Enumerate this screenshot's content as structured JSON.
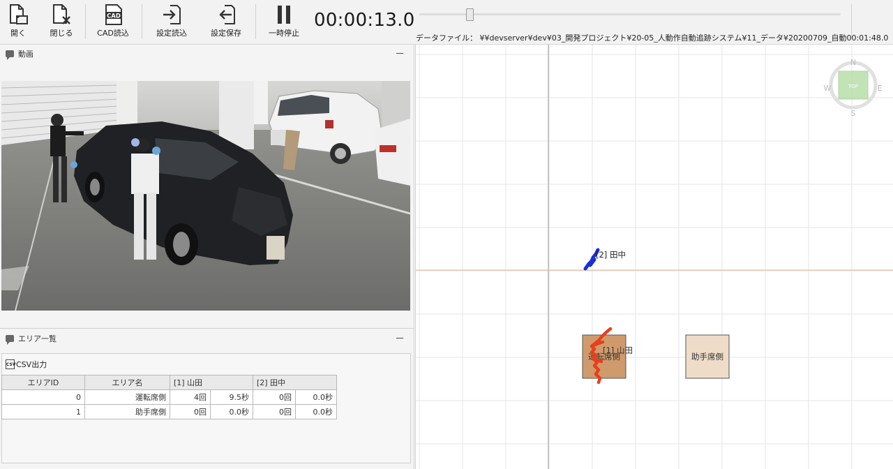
{
  "toolbar": {
    "open_label": "開く",
    "close_label": "閉じる",
    "cad_label": "CAD読込",
    "cad_icon_text": "CAD",
    "load_settings_label": "設定読込",
    "save_settings_label": "設定保存",
    "pause_label": "一時停止",
    "timer": "00:00:13.0",
    "playback_position": 0.12,
    "data_file": "データファイル： ¥¥devserver¥dev¥03_開発プロジェクト¥20-05_人動作自動追跡システム¥11_データ¥20200709_自動00:01:48.0"
  },
  "video_panel": {
    "title": "動画",
    "minimize": "－"
  },
  "area_panel": {
    "title": "エリア一覧",
    "minimize": "－",
    "csv_label": "CSV出力",
    "csv_icon_text": "CSV",
    "table": {
      "headers": [
        "エリアID",
        "エリア名",
        "[1] 山田",
        "[2] 田中"
      ],
      "rows": [
        {
          "id": "0",
          "name": "運転席側",
          "p1_count": "4回",
          "p1_time": "9.5秒",
          "p2_count": "0回",
          "p2_time": "0.0秒"
        },
        {
          "id": "1",
          "name": "助手席側",
          "p1_count": "0回",
          "p1_time": "0.0秒",
          "p2_count": "0回",
          "p2_time": "0.0秒"
        }
      ]
    }
  },
  "map": {
    "compass": {
      "n": "N",
      "s": "S",
      "e": "E",
      "w": "W",
      "top": "TOP"
    },
    "person_tanaka_label": "[2] 田中",
    "person_yamada_label": "[1] 山田",
    "area_driver": "運転席側",
    "area_passenger": "助手席側",
    "colors": {
      "tanaka_track": "#1a2fd6",
      "yamada_track": "#e8401c",
      "driver_area": "#cf9b6c",
      "passenger_area": "#efdcc8",
      "horizon_line": "#e8b393",
      "compass_green": "#b7dfaa"
    }
  }
}
